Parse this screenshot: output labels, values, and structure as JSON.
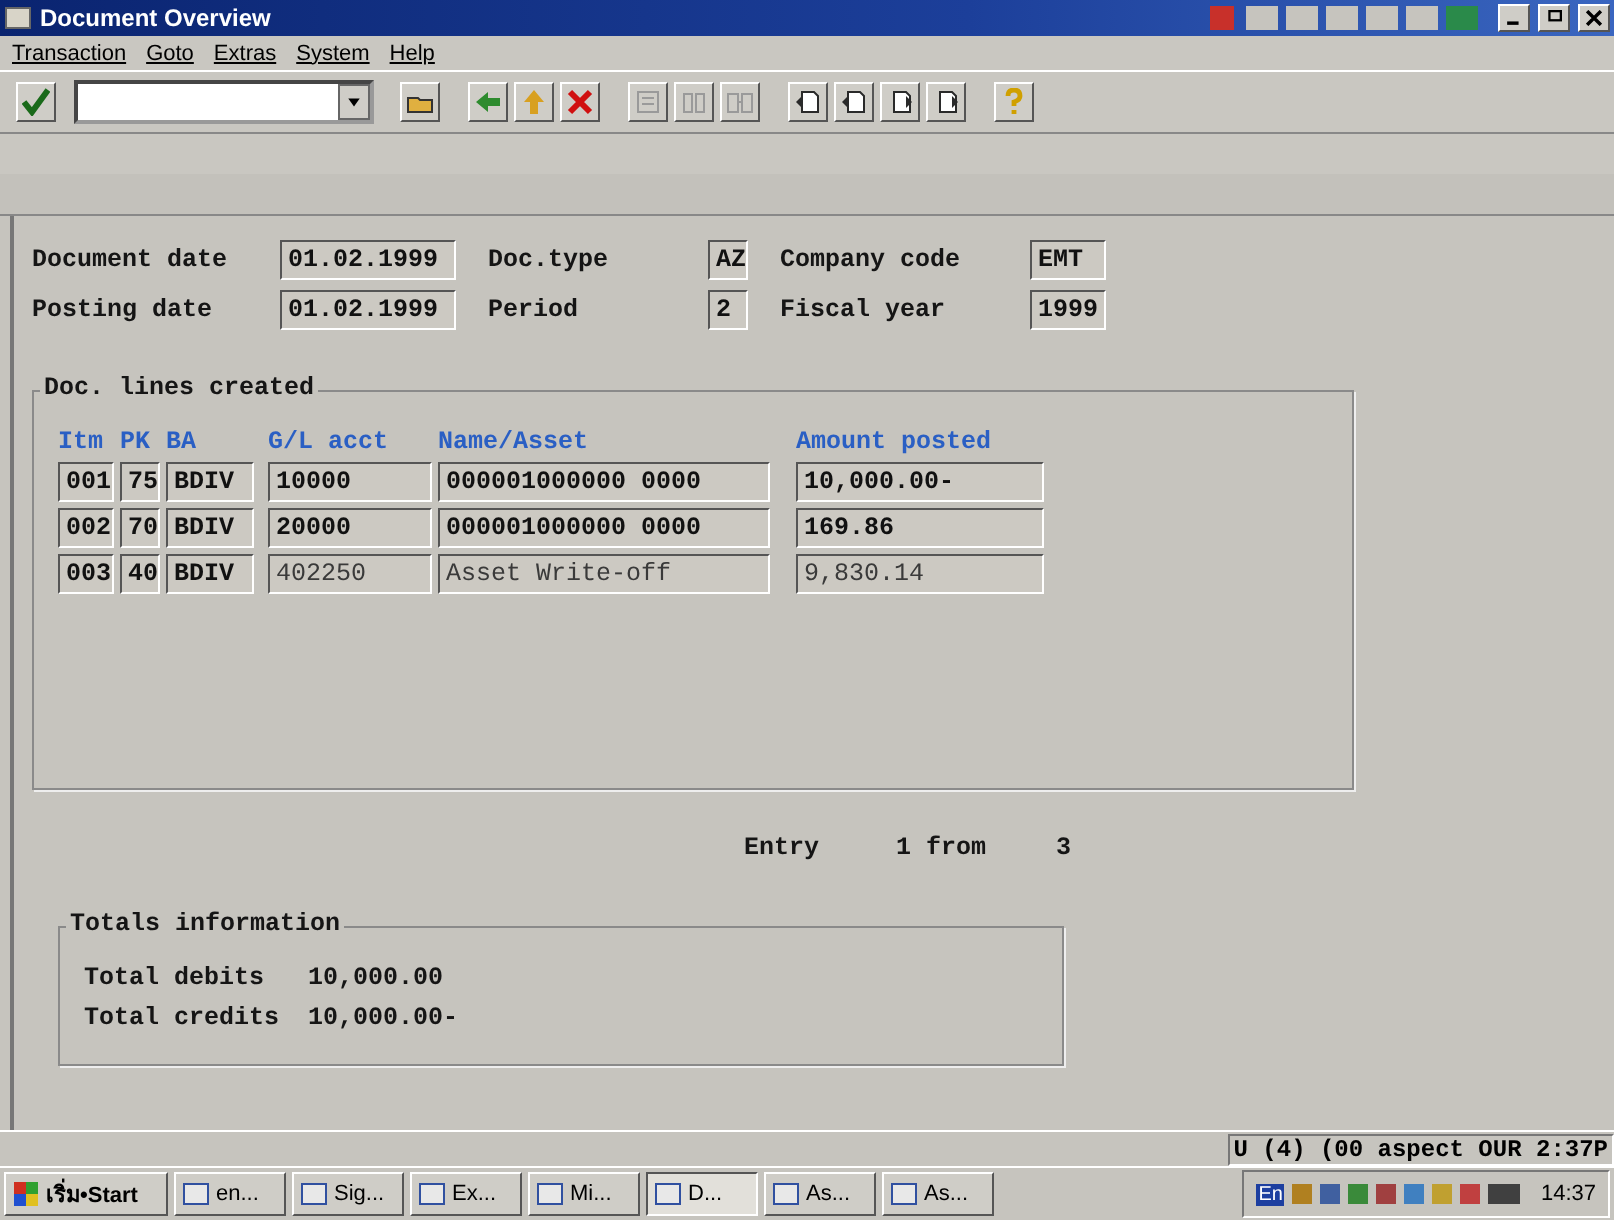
{
  "window": {
    "title": "Document Overview"
  },
  "menu": [
    "Transaction",
    "Goto",
    "Extras",
    "System",
    "Help"
  ],
  "toolbar": {
    "buttons": [
      {
        "kind": "back",
        "disabled": false
      },
      {
        "kind": "up",
        "disabled": false
      },
      {
        "kind": "cancel",
        "disabled": false
      },
      {
        "kind": "print",
        "disabled": true
      },
      {
        "kind": "find",
        "disabled": true
      },
      {
        "kind": "findnext",
        "disabled": true
      },
      {
        "kind": "first",
        "disabled": false
      },
      {
        "kind": "prev",
        "disabled": false
      },
      {
        "kind": "next",
        "disabled": false
      },
      {
        "kind": "last",
        "disabled": false
      }
    ]
  },
  "header": [
    {
      "label": "Document date",
      "value": "01.02.1999",
      "label2": "Doc.type",
      "value2": "AZ",
      "label3": "Company code",
      "value3": "EMT"
    },
    {
      "label": "Posting date",
      "value": "01.02.1999",
      "label2": "Period",
      "value2": "2",
      "label3": "Fiscal year",
      "value3": "1999"
    }
  ],
  "lines": {
    "title": "Doc. lines created",
    "columns": [
      "Itm",
      "PK",
      "BA",
      "G/L acct",
      "Name/Asset",
      "Amount posted"
    ],
    "rows": [
      {
        "cells": [
          "001",
          "75",
          "BDIV",
          "10000",
          "000001000000 0000",
          "10,000.00-"
        ],
        "editable": false
      },
      {
        "cells": [
          "002",
          "70",
          "BDIV",
          "20000",
          "000001000000 0000",
          "169.86"
        ],
        "editable": false
      },
      {
        "cells": [
          "003",
          "40",
          "BDIV",
          "402250",
          "Asset Write-off",
          "9,830.14"
        ],
        "editable": true
      }
    ]
  },
  "entry": [
    "Entry",
    "1 from",
    "3"
  ],
  "totals": {
    "title": "Totals information",
    "rows": [
      {
        "label": "Total debits",
        "value": "10,000.00"
      },
      {
        "label": "Total credits",
        "value": "10,000.00-"
      }
    ]
  },
  "status_bar": "U (4) (00 aspect OUR 2:37P",
  "taskbar": {
    "start": "เริ่ม•Start",
    "tasks": [
      {
        "label": "en...",
        "selected": false
      },
      {
        "label": "Sig...",
        "selected": false
      },
      {
        "label": "Ex...",
        "selected": false
      },
      {
        "label": "Mi...",
        "selected": false
      },
      {
        "label": "D...",
        "selected": true
      },
      {
        "label": "As...",
        "selected": false
      },
      {
        "label": "As...",
        "selected": false
      }
    ],
    "language": "En",
    "clock": "14:37"
  }
}
